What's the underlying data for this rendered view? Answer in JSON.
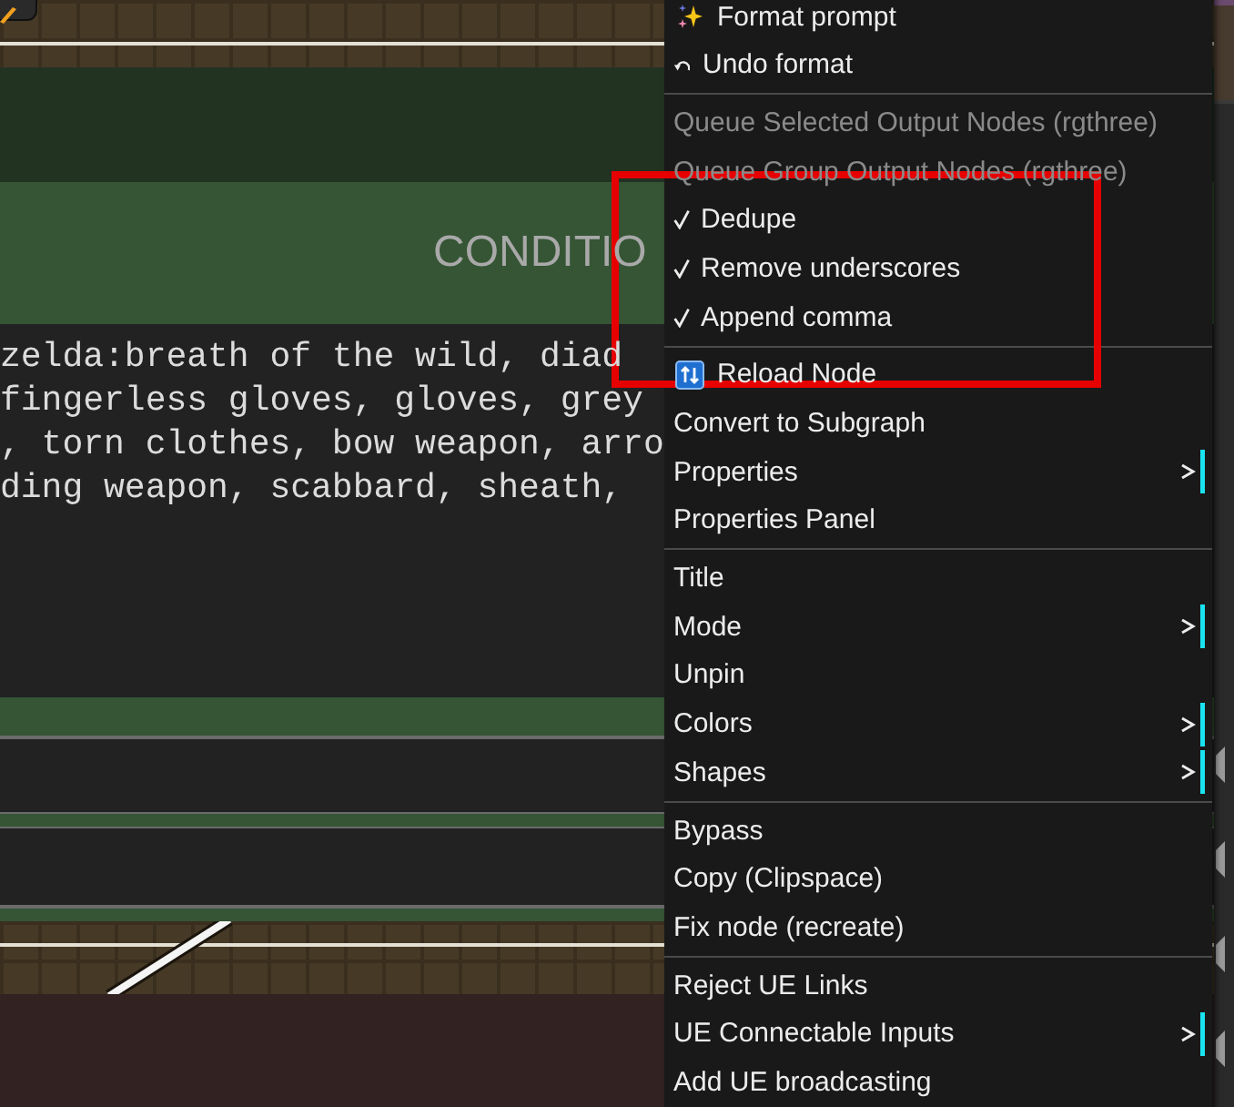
{
  "canvas": {
    "node": {
      "title": "CONDITIO",
      "prompt_lines": [
        "zelda:breath of the wild, diad",
        "fingerless gloves, gloves, grey",
        ", torn clothes, bow weapon, arro",
        "ding weapon, scabbard, sheath,"
      ]
    }
  },
  "context_menu": {
    "sections": [
      {
        "items": [
          {
            "label": "Format prompt",
            "kind": "format",
            "disabled": false
          },
          {
            "label": "Undo format",
            "kind": "undo",
            "disabled": false
          }
        ]
      },
      {
        "items": [
          {
            "label": "Queue Selected Output Nodes (rgthree)",
            "kind": "plain",
            "disabled": true
          },
          {
            "label": "Queue Group Output Nodes (rgthree)",
            "kind": "plain",
            "disabled": true
          },
          {
            "label": "Dedupe",
            "kind": "toggle",
            "checked": true,
            "disabled": false
          },
          {
            "label": "Remove underscores",
            "kind": "toggle",
            "checked": true,
            "disabled": false
          },
          {
            "label": "Append comma",
            "kind": "toggle",
            "checked": true,
            "disabled": false
          }
        ]
      },
      {
        "items": [
          {
            "label": "Reload Node",
            "kind": "reload",
            "disabled": false
          },
          {
            "label": "Convert to Subgraph",
            "kind": "plain",
            "disabled": false
          },
          {
            "label": "Properties",
            "kind": "submenu",
            "disabled": false
          },
          {
            "label": "Properties Panel",
            "kind": "plain",
            "disabled": false
          }
        ]
      },
      {
        "items": [
          {
            "label": "Title",
            "kind": "plain",
            "disabled": false
          },
          {
            "label": "Mode",
            "kind": "submenu",
            "disabled": false
          },
          {
            "label": "Unpin",
            "kind": "plain",
            "disabled": false
          },
          {
            "label": "Colors",
            "kind": "submenu",
            "disabled": false
          },
          {
            "label": "Shapes",
            "kind": "submenu",
            "disabled": false
          }
        ]
      },
      {
        "items": [
          {
            "label": "Bypass",
            "kind": "plain",
            "disabled": false
          },
          {
            "label": "Copy (Clipspace)",
            "kind": "plain",
            "disabled": false
          },
          {
            "label": "Fix node (recreate)",
            "kind": "plain",
            "disabled": false
          }
        ]
      },
      {
        "items": [
          {
            "label": "Reject UE Links",
            "kind": "plain",
            "disabled": false
          },
          {
            "label": "UE Connectable Inputs",
            "kind": "submenu",
            "disabled": false
          },
          {
            "label": "Add UE broadcasting",
            "kind": "plain",
            "disabled": false
          }
        ]
      }
    ]
  },
  "annotations": [
    {
      "kind": "rectangle"
    }
  ]
}
